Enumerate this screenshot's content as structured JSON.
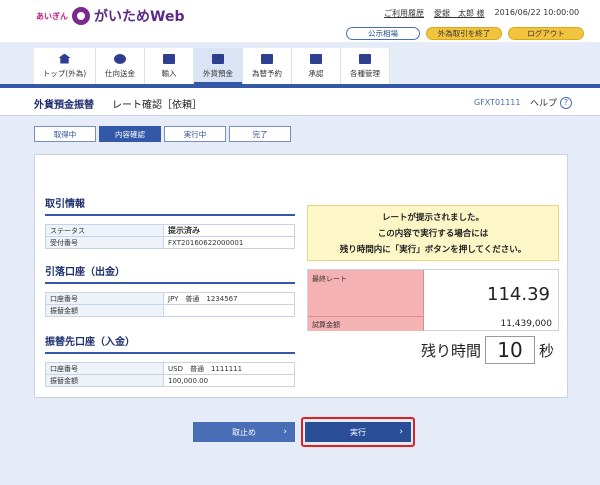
{
  "header": {
    "logo_prefix": "あいぎん",
    "logo_name": "がいためWeb",
    "usage_history": "ご利用履歴",
    "user_name": "愛銀　太郎 様",
    "datetime": "2016/06/22 10:00:00",
    "market_btn": "公示相場",
    "end_fx_btn": "外為取引を終了",
    "logout_btn": "ログアウト"
  },
  "nav": {
    "items": [
      {
        "label": "トップ(外為)"
      },
      {
        "label": "仕向送金"
      },
      {
        "label": "輸入"
      },
      {
        "label": "外貨預金"
      },
      {
        "label": "為替予約"
      },
      {
        "label": "承認"
      },
      {
        "label": "各種管理"
      }
    ]
  },
  "title_bar": {
    "title": "外貨預金振替",
    "subtitle": "レート確認［依頼］",
    "screen_id": "GFXT01111",
    "help": "ヘルプ"
  },
  "steps": [
    "取得中",
    "内容確認",
    "実行中",
    "完了"
  ],
  "trade_info": {
    "title": "取引情報",
    "rows": [
      {
        "k": "ステータス",
        "v": "提示済み"
      },
      {
        "k": "受付番号",
        "v": "FXT20160622000001"
      }
    ]
  },
  "debit": {
    "title": "引落口座（出金）",
    "rows": [
      {
        "k": "口座番号",
        "v": "JPY　普通　1234567"
      },
      {
        "k": "振替金額",
        "v": ""
      }
    ]
  },
  "credit": {
    "title": "振替先口座（入金）",
    "rows": [
      {
        "k": "口座番号",
        "v": "USD　普通　1111111"
      },
      {
        "k": "振替金額",
        "v": "100,000.00"
      }
    ]
  },
  "notice": [
    "レートが提示されました。",
    "この内容で実行する場合には",
    "残り時間内に「実行」ボタンを押してください。"
  ],
  "rate": {
    "rate_label": "最終レート",
    "rate_value": "114.39",
    "amount_label": "試算金額",
    "amount_value": "11,439,000"
  },
  "remain": {
    "label": "残り時間",
    "value": "10",
    "unit": "秒"
  },
  "buttons": {
    "cancel": "取止め",
    "execute": "実行"
  }
}
